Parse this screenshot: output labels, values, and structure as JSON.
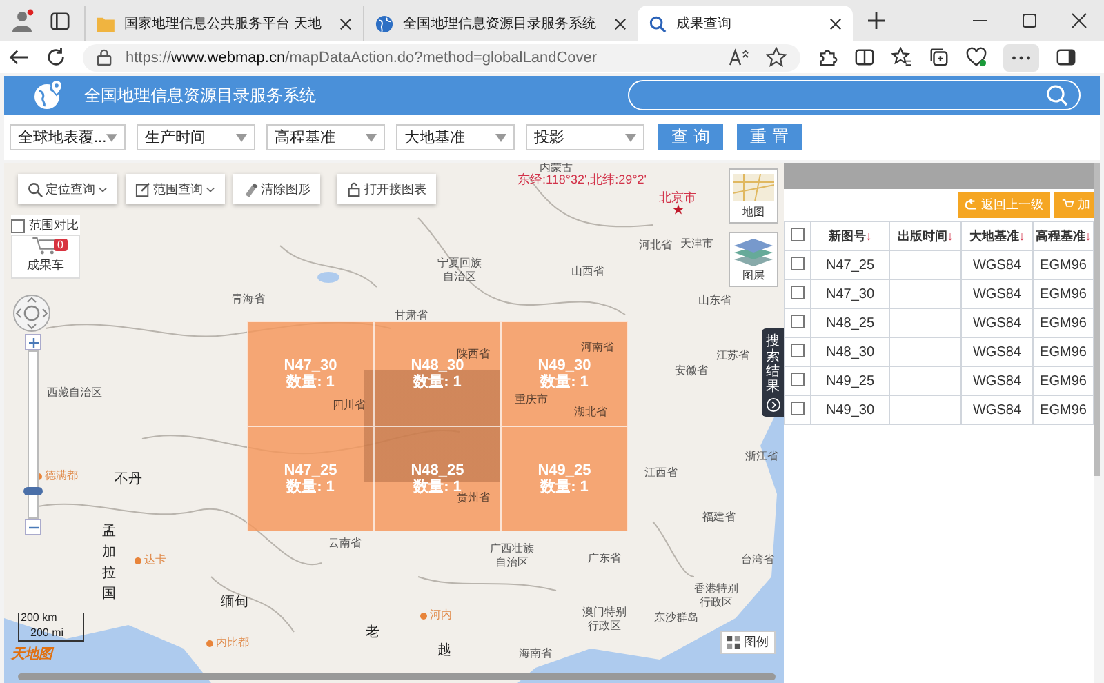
{
  "browser": {
    "tabs": [
      {
        "title": "国家地理信息公共服务平台 天地",
        "kind": "folder",
        "selected": false
      },
      {
        "title": "全国地理信息资源目录服务系统",
        "kind": "globe",
        "selected": false
      },
      {
        "title": "成果查询",
        "kind": "search",
        "selected": true
      }
    ],
    "url": "https://**www.webmap.cn**/mapDataAction.do?method=globalLandCover"
  },
  "header": {
    "title": "全国地理信息资源目录服务系统"
  },
  "filters": [
    {
      "value": "全球地表覆..."
    },
    {
      "value": "生产时间"
    },
    {
      "value": "高程基准"
    },
    {
      "value": "大地基准"
    },
    {
      "value": "投影"
    }
  ],
  "buttons": [
    "查询",
    "重置"
  ],
  "map": {
    "tools": [
      {
        "label": "定位查询",
        "kind": "locate",
        "dropdown": true
      },
      {
        "label": "范围查询",
        "kind": "range",
        "dropdown": true
      },
      {
        "label": "清除图形",
        "kind": "clear",
        "dropdown": false
      },
      {
        "label": "打开接图表",
        "kind": "lock",
        "dropdown": false
      }
    ],
    "compare": {
      "label": "范围对比",
      "checked": false
    },
    "cart": {
      "label": "成果车",
      "count": "0"
    },
    "coordinates": "东经:118°32',北纬:29°2'",
    "layers": [
      {
        "label": "地图",
        "kind": "map"
      },
      {
        "label": "图层",
        "kind": "layers"
      }
    ],
    "zoom": {
      "level": 0.13
    },
    "tiles": [
      {
        "name": "N47_30",
        "count": "数量: 1"
      },
      {
        "name": "N48_30",
        "count": "数量: 1"
      },
      {
        "name": "N49_30",
        "count": "数量: 1"
      },
      {
        "name": "N47_25",
        "count": "数量: 1"
      },
      {
        "name": "N48_25",
        "count": "数量: 1"
      },
      {
        "name": "N49_25",
        "count": "数量: 1"
      }
    ],
    "labels": [
      {
        "text": "内蒙古",
        "kind": "region"
      },
      {
        "text": "北京市",
        "kind": "capital"
      },
      {
        "text": "河北省",
        "kind": "region"
      },
      {
        "text": "天津市",
        "kind": "region"
      },
      {
        "text": "宁夏回族自治区",
        "kind": "region-wrapped"
      },
      {
        "text": "山西省",
        "kind": "region"
      },
      {
        "text": "青海省",
        "kind": "region"
      },
      {
        "text": "山东省",
        "kind": "region"
      },
      {
        "text": "甘肃省",
        "kind": "region"
      },
      {
        "text": "陕西省",
        "kind": "region"
      },
      {
        "text": "河南省",
        "kind": "region"
      },
      {
        "text": "江苏省",
        "kind": "region"
      },
      {
        "text": "安徽省",
        "kind": "region"
      },
      {
        "text": "西藏自治区",
        "kind": "region"
      },
      {
        "text": "四川省",
        "kind": "region"
      },
      {
        "text": "重庆市",
        "kind": "region"
      },
      {
        "text": "湖北省",
        "kind": "region"
      },
      {
        "text": "浙江省",
        "kind": "region"
      },
      {
        "text": "德满都",
        "kind": "foreign-capital"
      },
      {
        "text": "不丹",
        "kind": "country"
      },
      {
        "text": "江西省",
        "kind": "region"
      },
      {
        "text": "贵州省",
        "kind": "region"
      },
      {
        "text": "福建省",
        "kind": "region"
      },
      {
        "text": "云南省",
        "kind": "region"
      },
      {
        "text": "孟加拉国",
        "kind": "country-vertical"
      },
      {
        "text": "达卡",
        "kind": "foreign-capital"
      },
      {
        "text": "广西壮族自治区",
        "kind": "region-wrapped"
      },
      {
        "text": "广东省",
        "kind": "region"
      },
      {
        "text": "台湾省",
        "kind": "region"
      },
      {
        "text": "缅甸",
        "kind": "country"
      },
      {
        "text": "香港特别行政区",
        "kind": "region-wrapped"
      },
      {
        "text": "河内",
        "kind": "foreign-capital"
      },
      {
        "text": "澳门特别行政区",
        "kind": "region-wrapped"
      },
      {
        "text": "东沙群岛",
        "kind": "region"
      },
      {
        "text": "内比都",
        "kind": "foreign-capital"
      },
      {
        "text": "老",
        "kind": "country"
      },
      {
        "text": "越",
        "kind": "country"
      },
      {
        "text": "海南省",
        "kind": "region"
      }
    ],
    "scale": [
      "200 km",
      "200 mi"
    ],
    "logo": "天地图",
    "legend": "图例",
    "side_tab": "搜索结果"
  },
  "results": {
    "back_button": "返回上一级",
    "add_button": "加",
    "header_checked": false,
    "columns": [
      {
        "label": "新图号",
        "sort": "↓"
      },
      {
        "label": "出版时间",
        "sort": "↓"
      },
      {
        "label": "大地基准",
        "sort": "↓"
      },
      {
        "label": "高程基准",
        "sort": "↓"
      }
    ],
    "rows": [
      {
        "checked": false,
        "sheet": "N47_25",
        "datum": "WGS84",
        "height_datum": "EGM96"
      },
      {
        "checked": false,
        "sheet": "N47_30",
        "datum": "WGS84",
        "height_datum": "EGM96"
      },
      {
        "checked": false,
        "sheet": "N48_25",
        "datum": "WGS84",
        "height_datum": "EGM96"
      },
      {
        "checked": false,
        "sheet": "N48_30",
        "datum": "WGS84",
        "height_datum": "EGM96"
      },
      {
        "checked": false,
        "sheet": "N49_25",
        "datum": "WGS84",
        "height_datum": "EGM96"
      },
      {
        "checked": false,
        "sheet": "N49_30",
        "datum": "WGS84",
        "height_datum": "EGM96"
      }
    ]
  }
}
